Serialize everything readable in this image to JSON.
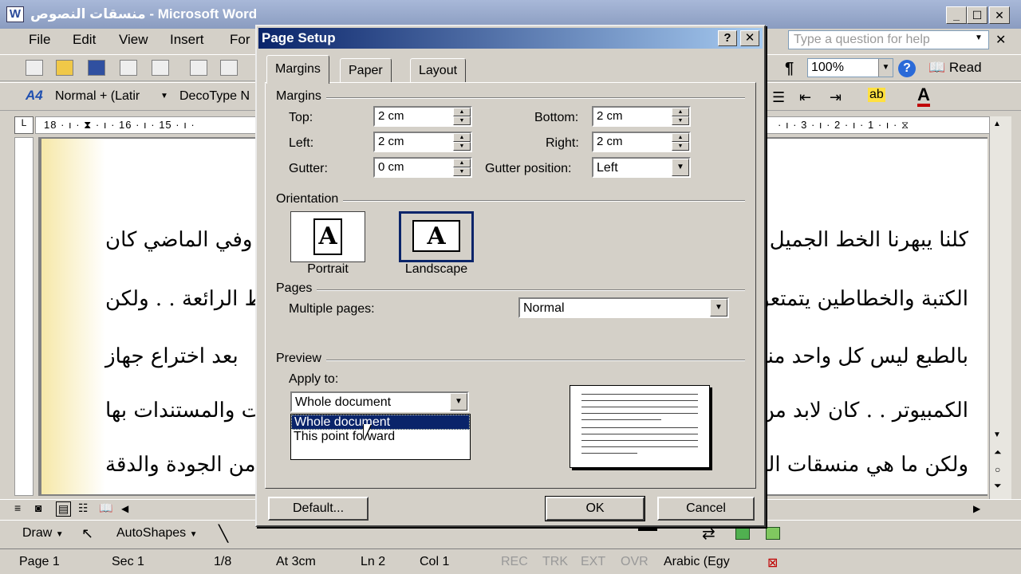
{
  "window": {
    "title": "منسقات النصوص - Microsoft Word",
    "icon": "W",
    "controls": {
      "minimize": "_",
      "restore": "☐",
      "close": "✕"
    }
  },
  "menu": {
    "items": [
      "File",
      "Edit",
      "View",
      "Insert",
      "For"
    ],
    "help_placeholder": "Type a question for help",
    "close": "✕"
  },
  "toolbar": {
    "zoom": "100%",
    "read_label": "Read",
    "pilcrow": "¶",
    "style_combo": "Normal + (Latir",
    "font_combo": "DecoType N",
    "style_glyph": "A4"
  },
  "ruler": {
    "left": "18 · ı · ⧗ · ı · 16 · ı · 15 · ı ·",
    "right": "· ı · 3 · ı · 2 · ı · 1 · ı · ⧖",
    "corner": "L"
  },
  "document": {
    "right_lines": [
      "كلنا يبهرنا الخط الجميل . .",
      "الكتبة والخطاطين يتمتعون",
      "بالطبع ليس كل واحد منا ل",
      "الكمبيوتر . . كان لابد من",
      "ولكن ما هي منسقات النص"
    ],
    "left_lines": [
      ". وفي الماضي كان",
      "ط الرائعة . . ولكن",
      "بعد اختراع جهاز",
      "ت والمستندات بها",
      "ل من الجودة والدقة"
    ]
  },
  "drawbar": {
    "draw_label": "Draw",
    "autoshapes_label": "AutoShapes"
  },
  "status": {
    "page": "Page 1",
    "sec": "Sec 1",
    "pages": "1/8",
    "at": "At 3cm",
    "ln": "Ln 2",
    "col": "Col 1",
    "rec": "REC",
    "trk": "TRK",
    "ext": "EXT",
    "ovr": "OVR",
    "language": "Arabic (Egy"
  },
  "dialog": {
    "title": "Page Setup",
    "help_btn": "?",
    "close_btn": "✕",
    "tabs": [
      "Margins",
      "Paper",
      "Layout"
    ],
    "active_tab": "Margins",
    "margins_group": "Margins",
    "top_label": "Top:",
    "top_value": "2 cm",
    "bottom_label": "Bottom:",
    "bottom_value": "2 cm",
    "left_label": "Left:",
    "left_value": "2 cm",
    "right_label": "Right:",
    "right_value": "2 cm",
    "gutter_label": "Gutter:",
    "gutter_value": "0 cm",
    "gutter_pos_label": "Gutter position:",
    "gutter_pos_value": "Left",
    "orientation_group": "Orientation",
    "portrait_label": "Portrait",
    "landscape_label": "Landscape",
    "orientation_glyph": "A",
    "selected_orientation": "Landscape",
    "pages_group": "Pages",
    "multiple_pages_label": "Multiple pages:",
    "multiple_pages_value": "Normal",
    "preview_group": "Preview",
    "apply_to_label": "Apply to:",
    "apply_to_value": "Whole document",
    "apply_options": [
      "Whole document",
      "This point forward"
    ],
    "default_btn": "Default...",
    "ok_btn": "OK",
    "cancel_btn": "Cancel"
  }
}
